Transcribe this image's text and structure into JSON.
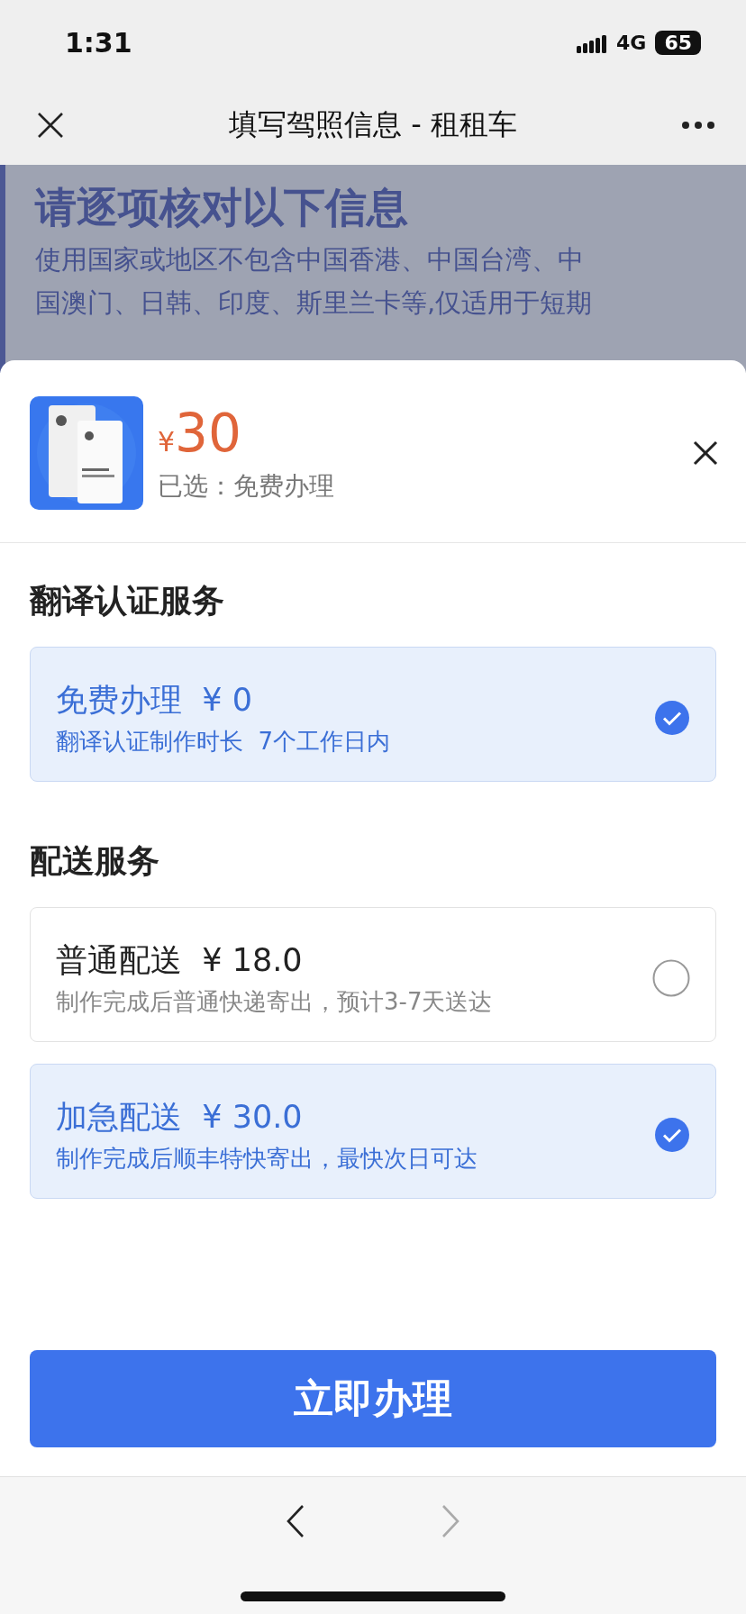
{
  "status_bar": {
    "time": "1:31",
    "network": "4G",
    "battery": "65"
  },
  "nav_bar": {
    "title": "填写驾照信息 - 租租车"
  },
  "background_page": {
    "heading": "请逐项核对以下信息",
    "text_lines": [
      "使用国家或地区不包含中国香港、中国台湾、中",
      "国澳门、日韩、印度、斯里兰卡等,仅适用于短期"
    ]
  },
  "sheet": {
    "product": {
      "currency": "¥",
      "price": "30",
      "selected_label": "已选：免费办理"
    },
    "sections": [
      {
        "title": "翻译认证服务",
        "options": [
          {
            "name": "免费办理",
            "price": "¥ 0",
            "description": "翻译认证制作时长  7个工作日内",
            "selected": true
          }
        ]
      },
      {
        "title": "配送服务",
        "options": [
          {
            "name": "普通配送",
            "price": "¥ 18.0",
            "description": "制作完成后普通快递寄出，预计3-7天送达",
            "selected": false
          },
          {
            "name": "加急配送",
            "price": "¥ 30.0",
            "description": "制作完成后顺丰特快寄出，最快次日可达",
            "selected": true
          }
        ]
      }
    ],
    "submit_button": "立即办理"
  },
  "bottom_toolbar": {
    "back_enabled": true,
    "forward_enabled": false
  }
}
